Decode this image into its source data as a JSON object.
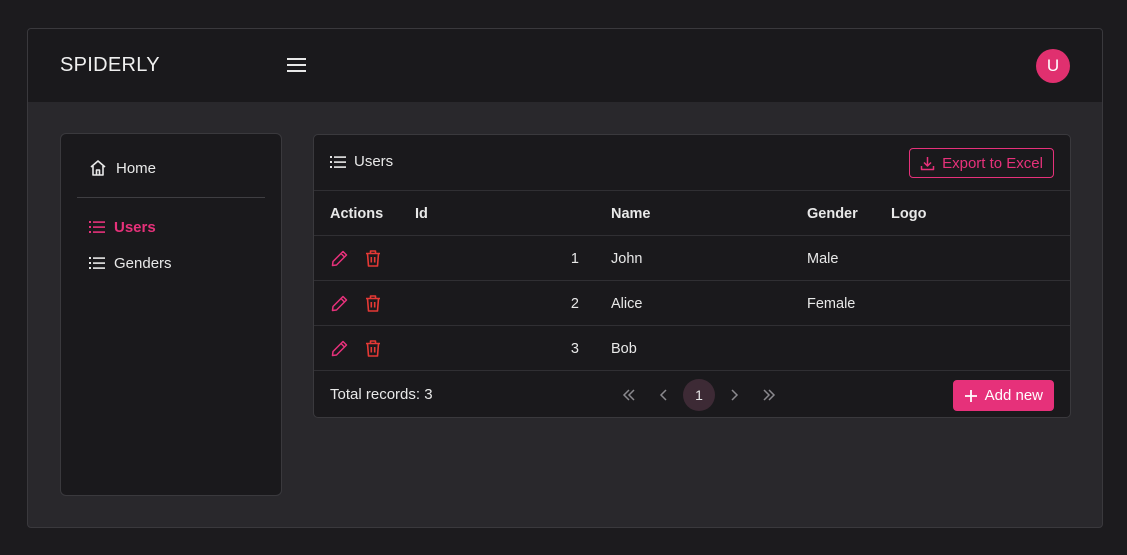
{
  "app": {
    "brand": "SPIDERLY",
    "avatar_initial": "U"
  },
  "colors": {
    "accent": "#e6317a",
    "danger": "#e53935",
    "background": "#29282c",
    "surface": "#1a191c"
  },
  "sidebar": {
    "items": [
      {
        "label": "Home",
        "icon": "home-icon",
        "active": false
      },
      {
        "label": "Users",
        "icon": "list-icon",
        "active": true
      },
      {
        "label": "Genders",
        "icon": "list-icon",
        "active": false
      }
    ]
  },
  "card": {
    "title": "Users",
    "export_label": "Export to Excel",
    "add_label": "Add new",
    "total_label": "Total records: 3"
  },
  "table": {
    "columns": [
      "Actions",
      "Id",
      "Name",
      "Gender",
      "Logo"
    ],
    "rows": [
      {
        "id": "1",
        "name": "John",
        "gender": "Male",
        "logo": ""
      },
      {
        "id": "2",
        "name": "Alice",
        "gender": "Female",
        "logo": ""
      },
      {
        "id": "3",
        "name": "Bob",
        "gender": "",
        "logo": ""
      }
    ]
  },
  "pagination": {
    "current_page": "1"
  }
}
